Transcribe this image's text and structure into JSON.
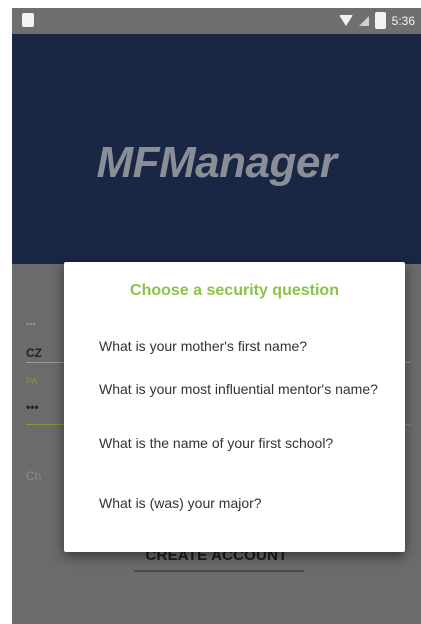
{
  "status_bar": {
    "time": "5:36"
  },
  "header": {
    "app_title": "MFManager"
  },
  "dialog": {
    "title": "Choose a security question",
    "options": [
      "What is your mother's first name?",
      "What is your most influential mentor's name?",
      "What is the name of your first school?",
      "What is (was) your major?"
    ]
  },
  "form": {
    "create_account_label": "CREATE ACCOUNT"
  },
  "colors": {
    "header_bg": "#1a2744",
    "dialog_title": "#8bc34a",
    "overlay_bg": "#6b6b6b"
  }
}
